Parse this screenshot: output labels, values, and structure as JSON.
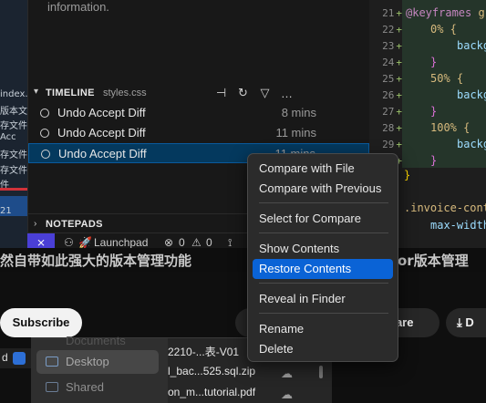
{
  "background_left": {
    "fragments": [
      "index.ht",
      "版本文件",
      "存文件",
      "Acc",
      "存文件",
      "存文件",
      "件",
      "21"
    ]
  },
  "explorer": {
    "info_text": "information."
  },
  "timeline": {
    "title": "TIMELINE",
    "file": "styles.css",
    "tools": [
      {
        "name": "pin-icon",
        "glyph": "⊣"
      },
      {
        "name": "refresh-icon",
        "glyph": "↻"
      },
      {
        "name": "filter-icon",
        "glyph": "▽"
      },
      {
        "name": "more-icon",
        "glyph": "…"
      }
    ],
    "items": [
      {
        "label": "Undo Accept Diff",
        "time": "8 mins"
      },
      {
        "label": "Undo Accept Diff",
        "time": "11 mins"
      },
      {
        "label": "Undo Accept Diff",
        "time": "11 mins"
      }
    ]
  },
  "notepads": {
    "title": "NOTEPADS"
  },
  "statusbar": {
    "remote_glyph": "⨯",
    "launchpad": "Launchpad",
    "errors": "0",
    "warnings": "0"
  },
  "editor": {
    "lines": [
      {
        "n": "21",
        "code_kw": "@keyframes",
        "code_rest": " gr"
      },
      {
        "n": "22",
        "code": "0% {"
      },
      {
        "n": "23",
        "code": "backg"
      },
      {
        "n": "24",
        "code": "}"
      },
      {
        "n": "25",
        "code": "50% {"
      },
      {
        "n": "26",
        "code": "backg"
      },
      {
        "n": "27",
        "code": "}"
      },
      {
        "n": "28",
        "code": "100% {"
      },
      {
        "n": "29",
        "code": "backg"
      },
      {
        "n": "30",
        "code": "}"
      }
    ],
    "closing": "}",
    "selector": ".invoice-cont",
    "prop": "max-width"
  },
  "video": {
    "title_fragment_left": "然自带如此强大的版本管理功能",
    "title_fragment_right": "or版本管理",
    "subscribe": "Subscribe",
    "share": "hare",
    "download": "D"
  },
  "finder": {
    "sidebar": [
      {
        "label": "Documents"
      },
      {
        "label": "Desktop",
        "active": true
      },
      {
        "label": "Shared"
      }
    ],
    "files": [
      {
        "name": "2210-...表-V01"
      },
      {
        "name": "l_bac...525.sql.zip"
      },
      {
        "name": "on_m...tutorial.pdf"
      }
    ],
    "left_fragment": "d"
  },
  "context_menu": {
    "items": [
      {
        "label": "Compare with File"
      },
      {
        "label": "Compare with Previous"
      },
      {
        "label": "Select for Compare"
      },
      {
        "label": "Show Contents"
      },
      {
        "label": "Restore Contents",
        "highlighted": true
      },
      {
        "label": "Reveal in Finder"
      },
      {
        "label": "Rename"
      },
      {
        "label": "Delete"
      }
    ]
  }
}
